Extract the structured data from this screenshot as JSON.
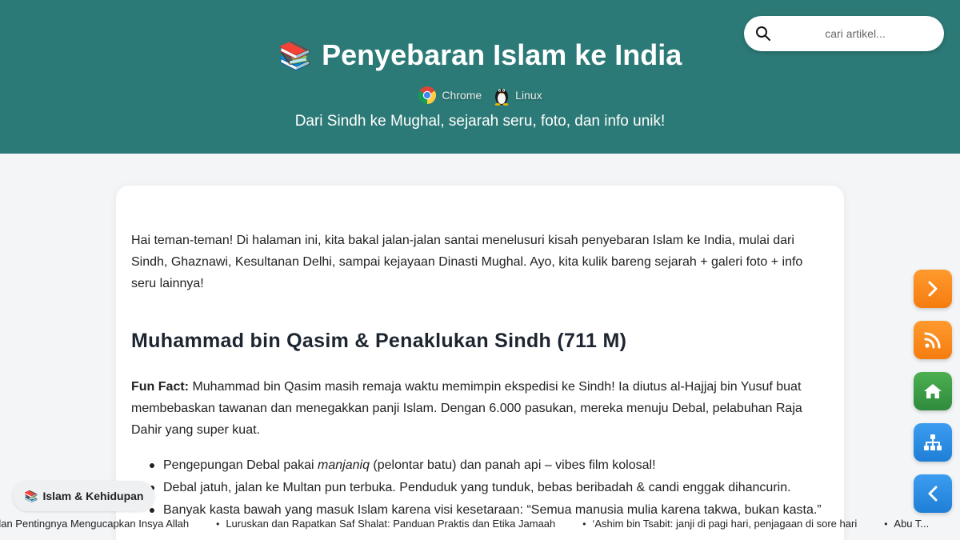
{
  "header": {
    "title_emoji": "📚",
    "title": "Penyebaran Islam ke India",
    "badges": [
      {
        "icon": "chrome-icon",
        "label": "Chrome"
      },
      {
        "icon": "linux-tux-icon",
        "label": "Linux"
      }
    ],
    "subtitle": "Dari Sindh ke Mughal, sejarah seru, foto, dan info unik!",
    "bg_color": "#2c7a77"
  },
  "search": {
    "icon": "search-icon",
    "placeholder": "cari artikel..."
  },
  "article": {
    "intro": "Hai teman-teman! Di halaman ini, kita bakal jalan-jalan santai menelusuri kisah penyebaran Islam ke India, mulai dari Sindh, Ghaznawi, Kesultanan Delhi, sampai kejayaan Dinasti Mughal. Ayo, kita kulik bareng sejarah + galeri foto + info seru lainnya!",
    "heading": "Muhammad bin Qasim & Penaklukan Sindh (711 M)",
    "fact_label": "Fun Fact:",
    "fact_text": " Muhammad bin Qasim masih remaja waktu memimpin ekspedisi ke Sindh! Ia diutus al-Hajjaj bin Yusuf buat membebaskan tawanan dan menegakkan panji Islam. Dengan 6.000 pasukan, mereka menuju Debal, pelabuhan Raja Dahir yang super kuat.",
    "bullets": [
      {
        "pre": "Pengepungan Debal pakai ",
        "em": "manjaniq",
        "post": " (pelontar batu) dan panah api – vibes film kolosal!"
      },
      {
        "pre": "Debal jatuh, jalan ke Multan pun terbuka. Penduduk yang tunduk, bebas beribadah & candi enggak dihancurin.",
        "em": "",
        "post": ""
      },
      {
        "pre": "Banyak kasta bawah yang masuk Islam karena visi kesetaraan: “Semua manusia mulia karena takwa, bukan kasta.”",
        "em": "",
        "post": ""
      }
    ]
  },
  "side_buttons": [
    {
      "icon": "chevron-right-icon",
      "color": "#f88a1f"
    },
    {
      "icon": "rss-icon",
      "color": "#f88a1f"
    },
    {
      "icon": "home-icon",
      "color": "#3fa14a"
    },
    {
      "icon": "sitemap-icon",
      "color": "#2d8ee6"
    },
    {
      "icon": "chevron-left-icon",
      "color": "#2d8ee6"
    }
  ],
  "category_chip": {
    "emoji": "📚",
    "label": "Islam & Kehidupan"
  },
  "ticker": [
    "dan Pentingnya Mengucapkan Insya Allah",
    "Luruskan dan Rapatkan Saf Shalat: Panduan Praktis dan Etika Jamaah",
    "‘Ashim bin Tsabit: janji di pagi hari, penjagaan di sore hari",
    "Abu T..."
  ]
}
